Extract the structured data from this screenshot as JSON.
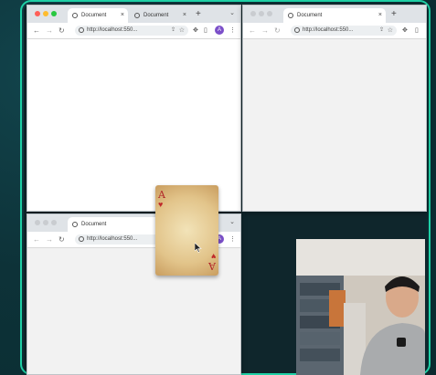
{
  "windows": {
    "top_left": {
      "tabs": [
        {
          "label": "Document",
          "close": "×"
        },
        {
          "label": "Document",
          "close": "×"
        }
      ],
      "new_tab": "+",
      "chevron": "⌄",
      "url": "http://localhost:550..."
    },
    "top_right": {
      "tabs": [
        {
          "label": "Document",
          "close": "×"
        }
      ],
      "new_tab": "+",
      "url": "http://localhost:550..."
    },
    "bottom_left": {
      "tabs": [
        {
          "label": "Document",
          "close": "×"
        }
      ],
      "new_tab": "+",
      "chevron": "⌄",
      "url": "http://localhost:550...",
      "avatar": "A"
    }
  },
  "card": {
    "rank": "A",
    "suit": "♥"
  },
  "colors": {
    "accent_border": "#1fd1a6",
    "traffic_red": "#ff5f57",
    "traffic_yellow": "#febc2e",
    "traffic_green": "#28c840",
    "avatar": "#7b4fc9"
  }
}
